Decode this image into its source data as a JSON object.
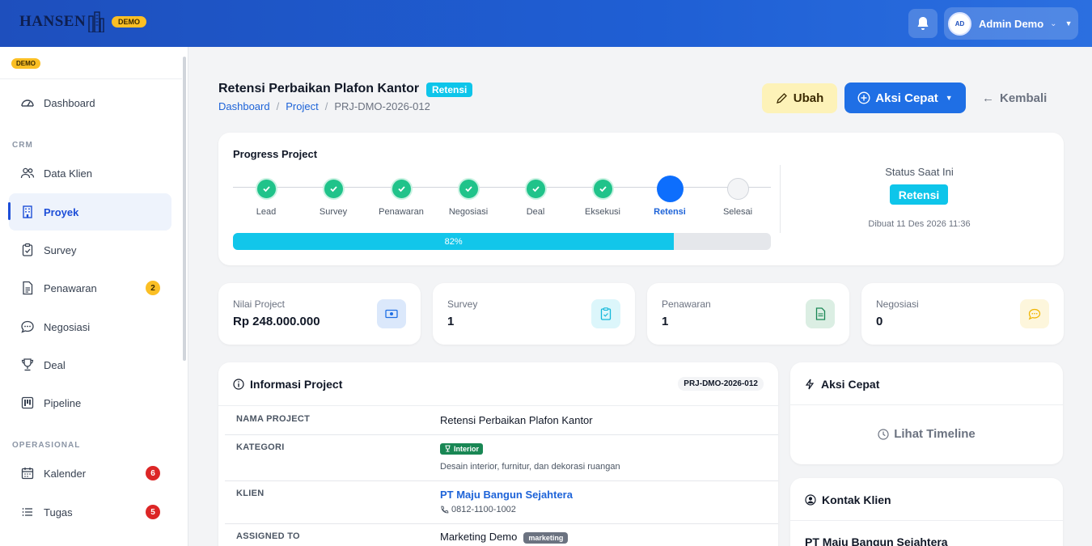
{
  "brand": {
    "logo_text": "HANSEN",
    "demo_label": "DEMO"
  },
  "topbar": {
    "user_initials": "AD",
    "user_name": "Admin Demo"
  },
  "sidebar": {
    "demo_label": "DEMO",
    "section_crm": "CRM",
    "section_ops": "OPERASIONAL",
    "items": [
      {
        "label": "Dashboard"
      },
      {
        "label": "Data Klien"
      },
      {
        "label": "Proyek"
      },
      {
        "label": "Survey"
      },
      {
        "label": "Penawaran",
        "badge": "2"
      },
      {
        "label": "Negosiasi"
      },
      {
        "label": "Deal"
      },
      {
        "label": "Pipeline"
      },
      {
        "label": "Kalender",
        "badge": "6"
      },
      {
        "label": "Tugas",
        "badge": "5"
      }
    ]
  },
  "header": {
    "title": "Retensi Perbaikan Plafon Kantor",
    "status_badge": "Retensi",
    "breadcrumb": [
      "Dashboard",
      "Project",
      "PRJ-DMO-2026-012"
    ],
    "btn_edit": "Ubah",
    "btn_quick": "Aksi Cepat",
    "btn_back": "Kembali"
  },
  "progress": {
    "title": "Progress Project",
    "steps": [
      "Lead",
      "Survey",
      "Penawaran",
      "Negosiasi",
      "Deal",
      "Eksekusi",
      "Retensi",
      "Selesai"
    ],
    "current_index": 6,
    "percent": 82,
    "percent_label": "82%",
    "status_label": "Status Saat Ini",
    "status_value": "Retensi",
    "created": "Dibuat 11 Des 2026 11:36"
  },
  "stats": [
    {
      "label": "Nilai Project",
      "value": "Rp 248.000.000",
      "icon": "money-icon"
    },
    {
      "label": "Survey",
      "value": "1",
      "icon": "clipboard-icon"
    },
    {
      "label": "Penawaran",
      "value": "1",
      "icon": "file-icon"
    },
    {
      "label": "Negosiasi",
      "value": "0",
      "icon": "chat-icon"
    }
  ],
  "info": {
    "title": "Informasi Project",
    "code": "PRJ-DMO-2026-012",
    "rows": {
      "nama_key": "NAMA PROJECT",
      "nama_val": "Retensi Perbaikan Plafon Kantor",
      "kategori_key": "KATEGORI",
      "kategori_tag": "Interior",
      "kategori_desc": "Desain interior, furnitur, dan dekorasi ruangan",
      "klien_key": "KLIEN",
      "klien_val": "PT Maju Bangun Sejahtera",
      "klien_phone": "0812-1100-1002",
      "assigned_key": "ASSIGNED TO",
      "assigned_val": "Marketing Demo",
      "assigned_role": "marketing"
    }
  },
  "quick": {
    "title": "Aksi Cepat",
    "timeline": "Lihat Timeline"
  },
  "contact": {
    "title": "Kontak Klien",
    "name": "PT Maju Bangun Sejahtera"
  },
  "colors": {
    "primary": "#1f6fe5",
    "info": "#0ec5ea",
    "success": "#20c38a",
    "warning": "#fbbf24",
    "danger": "#dc2626"
  }
}
